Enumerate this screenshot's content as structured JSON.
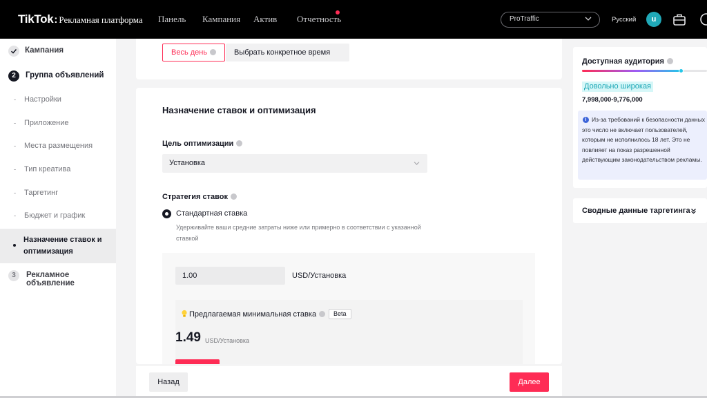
{
  "topbar": {
    "logo": "TikTok",
    "logo_colon": ":",
    "logo_sub": "Рекламная платформа",
    "nav": [
      "Панель",
      "Кампания",
      "Актив",
      "Отчетность"
    ],
    "account": "ProTraffic",
    "language": "Русский",
    "avatar_initial": "u"
  },
  "sidebar": {
    "campaign": "Кампания",
    "ad_group_number": "2",
    "ad_group": "Группа объявлений",
    "sub_items": [
      "Настройки",
      "Приложение",
      "Места размещения",
      "Тип креатива",
      "Таргетинг",
      "Бюджет и график"
    ],
    "active_item": "Назначение ставок и оптимизация",
    "ad_number": "3",
    "ad": "Рекламное объявление"
  },
  "schedule": {
    "all_day": "Весь день",
    "specific_time": "Выбрать конкретное время"
  },
  "bidding": {
    "title": "Назначение ставок и оптимизация",
    "goal_label": "Цель оптимизации",
    "goal_value": "Установка",
    "strategy_label": "Стратегия ставок",
    "strategy_option": "Стандартная ставка",
    "strategy_desc": "Удерживайте ваши средние затраты ниже или примерно в соответствии с указанной ставкой",
    "bid_value": "1.00",
    "bid_unit": "USD/Установка",
    "suggest_label": "Предлагаемая минимальная ставка",
    "beta": "Beta",
    "suggest_value": "1.49",
    "suggest_unit": "USD/Установка"
  },
  "footer": {
    "back": "Назад",
    "next": "Далее"
  },
  "audience": {
    "title": "Доступная аудитория",
    "breadth": "Довольно широкая",
    "range": "7,998,000-9,776,000",
    "level": 0.79,
    "notice": "Из-за требований к безопасности данных это число не включает пользователей, которым не исполнилось 18 лет. Это не повлияет на показ разрешенной действующим законодательством рекламы."
  },
  "summary": {
    "title": "Сводные данные таргетинга"
  },
  "colors": {
    "accent": "#fe2c55",
    "teal": "#20a9b8",
    "info": "#3c64d9"
  }
}
